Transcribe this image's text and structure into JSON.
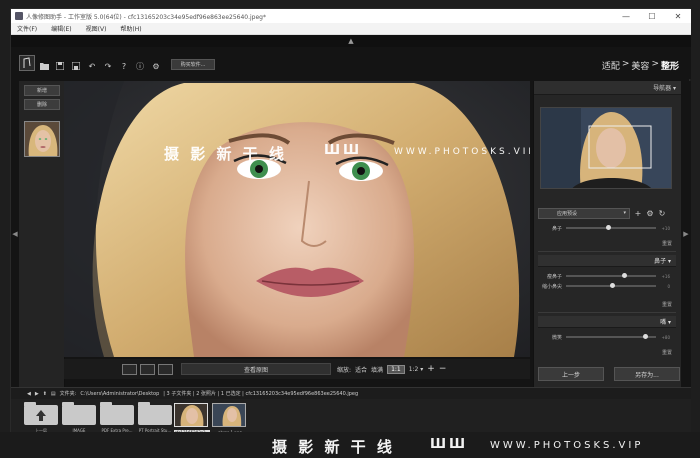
{
  "window": {
    "title": "人像修图助手 - 工作室版 5.0(64位) - cfc13165203c34e95edf96e863ee25640.jpeg*",
    "min_glyph": "—",
    "max_glyph": "☐",
    "close_glyph": "✕"
  },
  "menu": {
    "file": "文件(F)",
    "edit": "编辑(E)",
    "view": "视图(V)",
    "help": "帮助(H)"
  },
  "top_arrow": "▲",
  "toolbar": {
    "buy_label": "购买软件...",
    "icons": [
      "folder-open-icon",
      "save-icon",
      "save-as-icon",
      "undo-icon",
      "redo-icon",
      "help-icon",
      "info-icon",
      "settings-icon"
    ]
  },
  "modes": {
    "fit": "适配",
    "sep1": ">",
    "beauty": "美容",
    "sep2": ">",
    "shape": "整形"
  },
  "left_panel": {
    "add_label": "新增",
    "delete_label": "删除"
  },
  "view_bar": {
    "compare_label": "查看原图",
    "zoom_label": "缩放:",
    "fit_label": "适合",
    "fill_label": "填满",
    "ratio_1_1": "1:1",
    "ratio_1_2": "1:2 ▾",
    "plus": "+",
    "minus": "−"
  },
  "right_panel": {
    "navigator_label": "导航器 ▾",
    "preset_label": "应用预设",
    "reset": "重置",
    "sec1_row": "鼻子",
    "sec1_val": "+10",
    "nose_header": "鼻子 ▾",
    "nose_sliders": [
      {
        "label": "瘦鼻子",
        "value": 0.65,
        "val_text": "+16"
      },
      {
        "label": "缩小鼻尖",
        "value": 0.52,
        "val_text": "0"
      }
    ],
    "mouth_header": "嘴 ▾",
    "mouth_sliders": [
      {
        "label": "微笑",
        "value": 0.88,
        "val_text": "+80"
      }
    ],
    "prev_label": "上一步",
    "save_as_label": "另存为..."
  },
  "file_bar": {
    "label": "文件夹:",
    "path": "C:\\Users\\Administrator\\Desktop",
    "info": "| 3 子文件夹 | 2 张照片 | 1 已选定 | cfc13165203c34e95edf96e863ee25640.jpeg"
  },
  "files": [
    {
      "label": "上一层",
      "kind": "up"
    },
    {
      "label": "IMAGE",
      "kind": "folder"
    },
    {
      "label": "PDF Extra Pre...",
      "kind": "folder"
    },
    {
      "label": "PT Portrait Stu...",
      "kind": "folder"
    },
    {
      "label": "cfc13165203c3...",
      "kind": "photo",
      "selected": true
    },
    {
      "label": "abrcc-1.png",
      "kind": "photo2"
    }
  ],
  "watermark": {
    "text1": "摄 影 新 干 线",
    "logo": "ШШ",
    "text2": "WWW.PHOTOSKS.VIP"
  }
}
